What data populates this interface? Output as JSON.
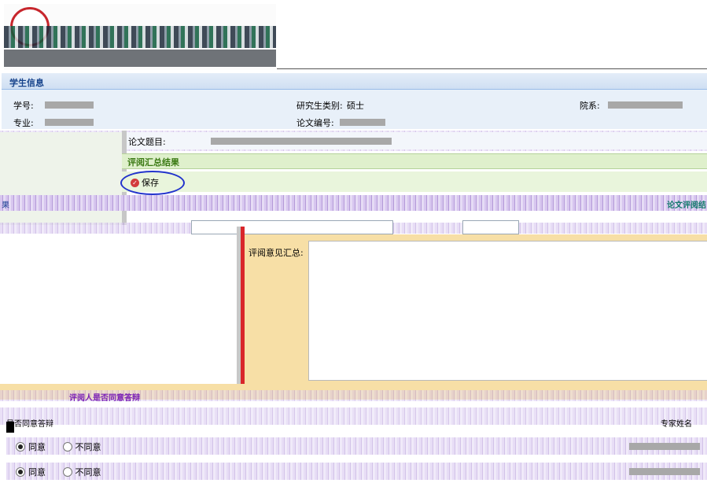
{
  "student_info": {
    "title": "学生信息",
    "student_no_label": "学号:",
    "major_label": "专业:",
    "category_label": "研究生类别:",
    "category_value": "硕士",
    "thesis_no_label": "论文编号:",
    "dept_label": "院系:"
  },
  "thesis": {
    "title_label": "论文题目:"
  },
  "review_summary": {
    "title": "评阅汇总结果",
    "save_label": "保存",
    "band_left": "果",
    "band_right": "论文评阅结",
    "opinion_label": "评阅意见汇总:"
  },
  "defense": {
    "title": "评阅人是否同意答辩",
    "col_agree": "是否同意答辩",
    "col_expert": "专家姓名",
    "rows": [
      {
        "agree": "同意",
        "disagree": "不同意",
        "selected": "agree"
      },
      {
        "agree": "同意",
        "disagree": "不同意",
        "selected": "agree"
      }
    ]
  },
  "colors": {
    "accent_blue": "#15428b",
    "accent_green": "#3b7a14",
    "form_bg": "#f7dfa6",
    "highlight_circle": "#2233cc"
  }
}
